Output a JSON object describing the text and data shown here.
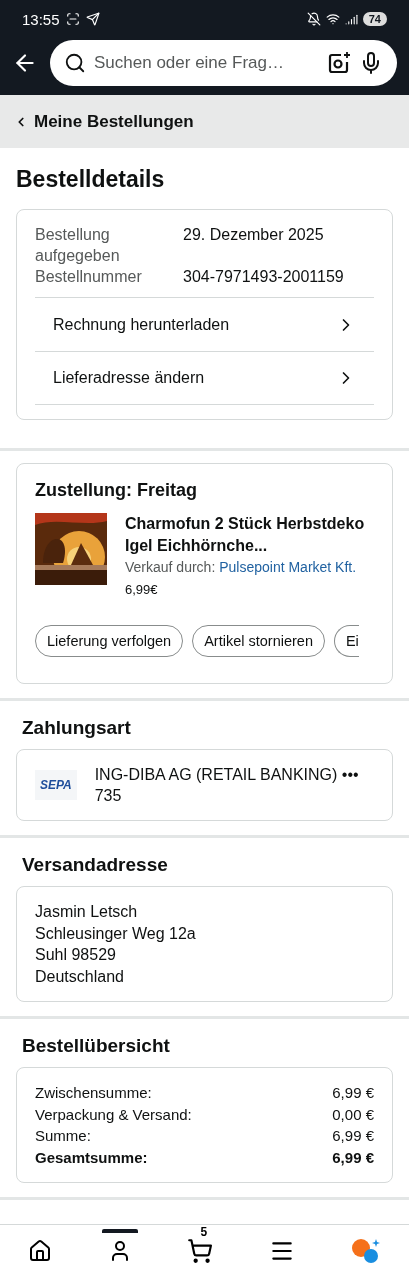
{
  "status_bar": {
    "time": "13:55",
    "battery": "74"
  },
  "search": {
    "placeholder": "Suchen oder eine Frag…"
  },
  "breadcrumb": {
    "label": "Meine Bestellungen"
  },
  "title": "Bestelldetails",
  "order_info": {
    "rows": [
      {
        "label": "Bestellung aufgegeben",
        "value": "29. Dezember 2025"
      },
      {
        "label": "Bestellnummer",
        "value": "304-7971493-2001159"
      }
    ],
    "links": [
      "Rechnung herunterladen",
      "Lieferadresse ändern"
    ]
  },
  "delivery": {
    "title": "Zustellung: Freitag",
    "product": {
      "name": "Charmofun 2 Stück Herbstdeko Igel Eichhörnche...",
      "seller_label": "Verkauf durch:",
      "seller": "Pulsepoint Market Kft.",
      "price": "6,99€"
    },
    "actions": [
      "Lieferung verfolgen",
      "Artikel stornieren",
      "Ei"
    ]
  },
  "payment": {
    "heading": "Zahlungsart",
    "logo": "SEPA",
    "text": "ING-DIBA AG (RETAIL BANKING) ••• 735"
  },
  "address": {
    "heading": "Versandadresse",
    "lines": [
      "Jasmin Letsch",
      "Schleusinger Weg 12a",
      "Suhl 98529",
      "Deutschland"
    ]
  },
  "summary": {
    "heading": "Bestellübersicht",
    "rows": [
      {
        "label": "Zwischensumme:",
        "value": "6,99 €",
        "total": false
      },
      {
        "label": "Verpackung & Versand:",
        "value": "0,00 €",
        "total": false
      },
      {
        "label": "Summe:",
        "value": "6,99 €",
        "total": false
      },
      {
        "label": "Gesamtsumme:",
        "value": "6,99 €",
        "total": true
      }
    ]
  },
  "bottom_nav": {
    "items": [
      {
        "kind": "home",
        "selected": false
      },
      {
        "kind": "account",
        "selected": true
      },
      {
        "kind": "cart",
        "badge": "5",
        "selected": false
      },
      {
        "kind": "menu",
        "selected": false
      },
      {
        "kind": "assistant",
        "selected": false
      }
    ]
  }
}
